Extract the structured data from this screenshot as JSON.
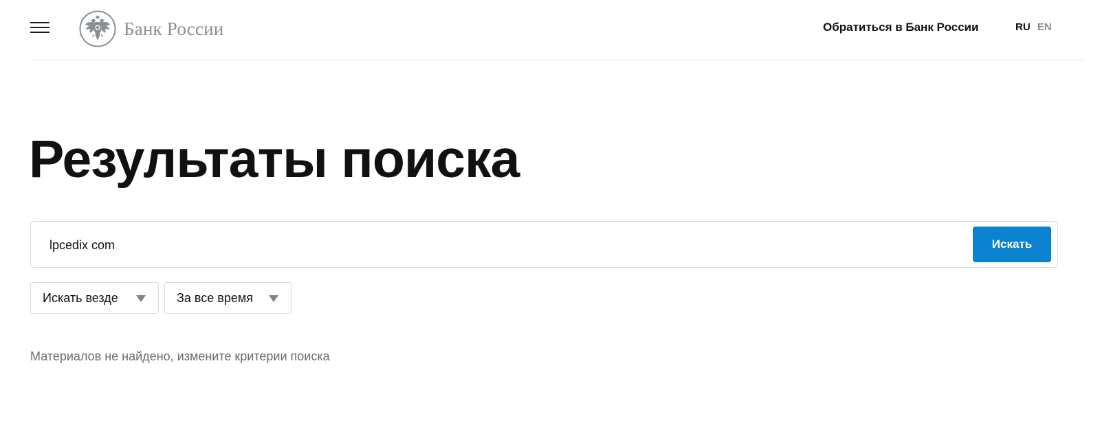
{
  "header": {
    "logo_text": "Банк России",
    "contact_link": "Обратиться в Банк России",
    "lang_ru": "RU",
    "lang_en": "EN"
  },
  "main": {
    "title": "Результаты поиска",
    "search": {
      "value": "lpcedix com",
      "button_label": "Искать"
    },
    "filters": [
      {
        "label": "Искать везде"
      },
      {
        "label": "За все время"
      }
    ],
    "empty_message": "Материалов не найдено, измените критерии поиска"
  },
  "icons": {
    "menu": "hamburger-menu-icon",
    "logo": "double-headed-eagle-emblem",
    "dropdown": "triangle-down-icon"
  },
  "colors": {
    "accent": "#0a82d0",
    "logo_gray": "#8a8f96",
    "muted_text": "#666c74",
    "border": "#d9dce0"
  }
}
